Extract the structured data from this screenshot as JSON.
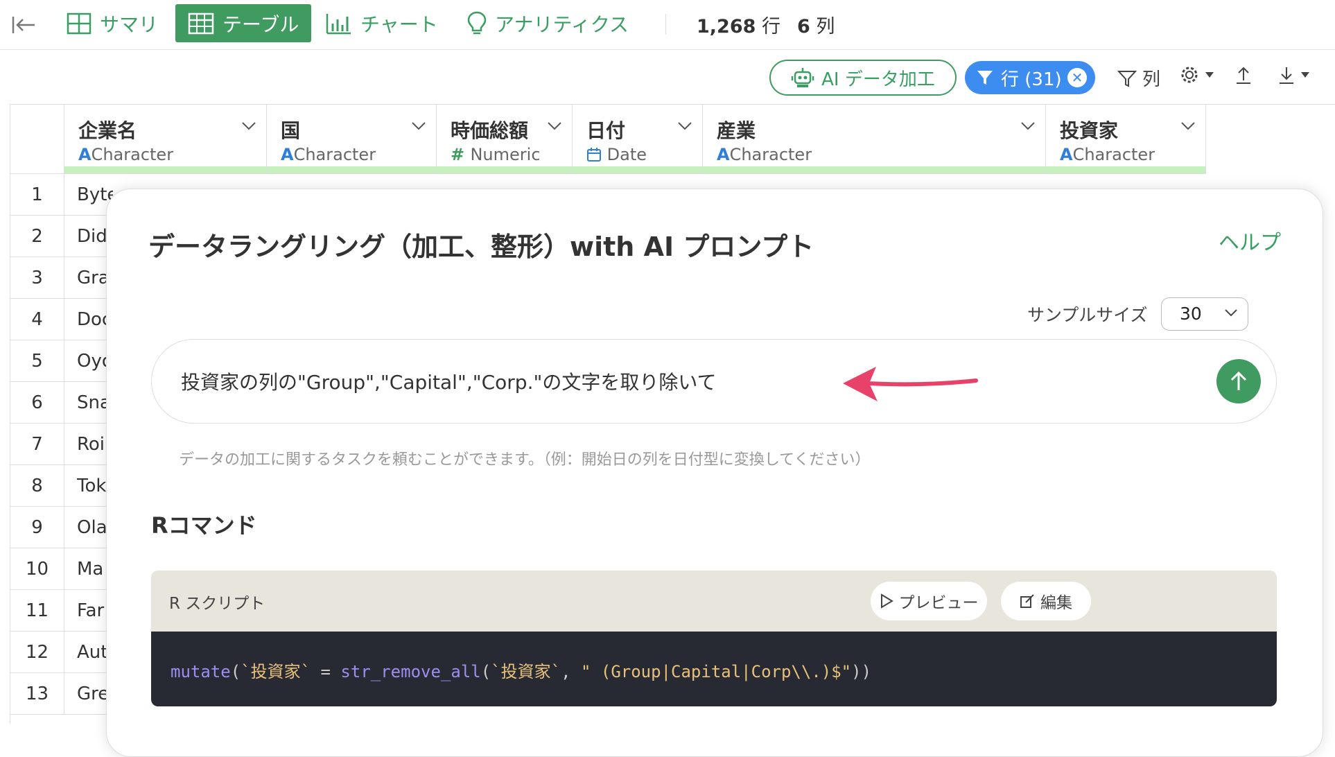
{
  "toolbar": {
    "tabs": [
      {
        "label": "サマリ",
        "icon": "grid-icon",
        "active": false
      },
      {
        "label": "テーブル",
        "icon": "table-icon",
        "active": true
      },
      {
        "label": "チャート",
        "icon": "bar-chart-icon",
        "active": false
      },
      {
        "label": "アナリティクス",
        "icon": "lightbulb-icon",
        "active": false
      }
    ],
    "rows_count": "1,268",
    "rows_unit": "行",
    "cols_count": "6",
    "cols_unit": "列"
  },
  "actions": {
    "ai_label": "AI データ加工",
    "filter_label": "行 (31)",
    "column_label": "列"
  },
  "table": {
    "columns": [
      {
        "name": "企業名",
        "type": "Character",
        "type_icon": "A"
      },
      {
        "name": "国",
        "type": "Character",
        "type_icon": "A"
      },
      {
        "name": "時価総額",
        "type": "Numeric",
        "type_icon": "#"
      },
      {
        "name": "日付",
        "type": "Date",
        "type_icon": "calendar"
      },
      {
        "name": "産業",
        "type": "Character",
        "type_icon": "A"
      },
      {
        "name": "投資家",
        "type": "Character",
        "type_icon": "A"
      }
    ],
    "rows": [
      {
        "n": "1",
        "c0": "Byted"
      },
      {
        "n": "2",
        "c0": "Did"
      },
      {
        "n": "3",
        "c0": "Gra"
      },
      {
        "n": "4",
        "c0": "Doc"
      },
      {
        "n": "5",
        "c0": "Oyo"
      },
      {
        "n": "6",
        "c0": "Sna"
      },
      {
        "n": "7",
        "c0": "Roi"
      },
      {
        "n": "8",
        "c0": "Tok"
      },
      {
        "n": "9",
        "c0": "Ola"
      },
      {
        "n": "10",
        "c0": "Ma"
      },
      {
        "n": "11",
        "c0": "Far"
      },
      {
        "n": "12",
        "c0": "Aut"
      },
      {
        "n": "13",
        "c0": "Gre"
      }
    ]
  },
  "modal": {
    "title": "データラングリング（加工、整形）with AI プロンプト",
    "help": "ヘルプ",
    "sample_label": "サンプルサイズ",
    "sample_value": "30",
    "prompt_text": "投資家の列の\"Group\",\"Capital\",\"Corp.\"の文字を取り除いて",
    "hint": "データの加工に関するタスクを頼むことができます。（例：開始日の列を日付型に変換してください）",
    "r_heading": "Rコマンド",
    "script_label": "R スクリプト",
    "preview_label": "プレビュー",
    "edit_label": "編集",
    "code": {
      "fn1": "mutate",
      "p1": "(",
      "s1": "`投資家`",
      "eq": " = ",
      "fn2": "str_remove_all",
      "p2": "(",
      "s2": "`投資家`",
      "comma": ", ",
      "s3": "\" (Group|Capital|Corp\\\\.)$\"",
      "p3": "))"
    }
  },
  "colors": {
    "accent_green": "#3f9b5f",
    "filter_blue": "#3d8df0",
    "annotation_arrow": "#e8426b"
  }
}
